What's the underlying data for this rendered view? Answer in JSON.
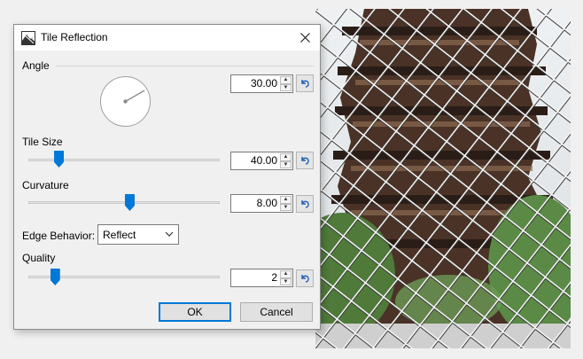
{
  "dialog": {
    "title": "Tile Reflection",
    "app_icon": "tile-reflection-app-icon",
    "close_icon": "close-icon"
  },
  "angle": {
    "label": "Angle",
    "value": "30.00",
    "degrees": 30
  },
  "tile_size": {
    "label": "Tile Size",
    "value": "40.00",
    "fraction": 0.16
  },
  "curvature": {
    "label": "Curvature",
    "value": "8.00",
    "fraction": 0.53
  },
  "edge_behavior": {
    "label": "Edge Behavior:",
    "selected": "Reflect"
  },
  "quality": {
    "label": "Quality",
    "value": "2",
    "fraction": 0.14
  },
  "buttons": {
    "ok": "OK",
    "cancel": "Cancel"
  },
  "icons": {
    "reset": "reset-arrow-icon",
    "spin_up": "spin-up-icon",
    "spin_down": "spin-down-icon"
  },
  "colors": {
    "accent": "#0078d7",
    "reset_icon": "#1a5fb4"
  }
}
